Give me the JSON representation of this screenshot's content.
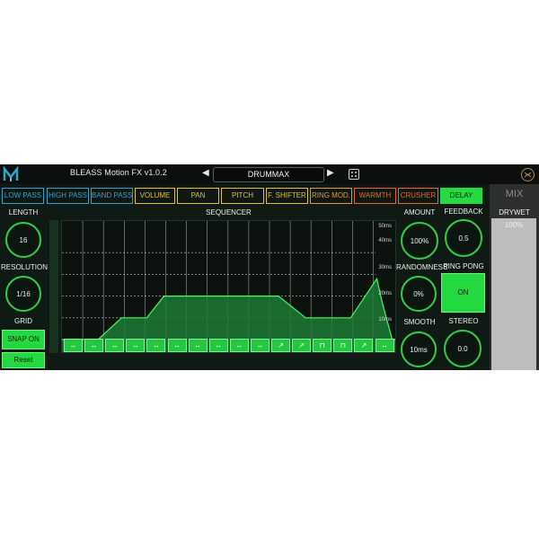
{
  "header": {
    "title": "BLEASS Motion FX  v1.0.2",
    "preset": "DRUMMAX",
    "prev_arrow": "◀",
    "next_arrow": "▶"
  },
  "tabs": [
    {
      "label": "LOW PASS",
      "color": "#3aa0c8"
    },
    {
      "label": "HIGH PASS",
      "color": "#3aa0c8"
    },
    {
      "label": "BAND PASS",
      "color": "#3aa0c8"
    },
    {
      "label": "VOLUME",
      "color": "#e0c23a"
    },
    {
      "label": "PAN",
      "color": "#e0c23a"
    },
    {
      "label": "PITCH",
      "color": "#e0c23a"
    },
    {
      "label": "F. SHIFTER",
      "color": "#e0c23a"
    },
    {
      "label": "RING MOD.",
      "color": "#e09a3a"
    },
    {
      "label": "WARMTH",
      "color": "#e06a3a"
    },
    {
      "label": "CRUSHER",
      "color": "#e06a3a"
    },
    {
      "label": "DELAY",
      "color": "#27d840",
      "active": true
    }
  ],
  "left": {
    "length_label": "LENGTH",
    "length_value": "16",
    "resolution_label": "RESOLUTION",
    "resolution_value": "1/16",
    "grid_label": "GRID",
    "snap_label": "SNAP ON",
    "reset_label": "Reset"
  },
  "sequencer": {
    "title": "SEQUENCER",
    "scale_labels": [
      "50ms",
      "40ms",
      "30ms",
      "20ms",
      "10ms",
      "0ms"
    ],
    "levels_ms": [
      0,
      10,
      10,
      20,
      20,
      20,
      20,
      20,
      20,
      20,
      20,
      10,
      10,
      10,
      10,
      10
    ],
    "step_shapes": [
      "↔",
      "↔",
      "↔",
      "↔",
      "↔",
      "↔",
      "↔",
      "↔",
      "↔",
      "↔",
      "↗",
      "↗",
      "⊓",
      "⊓",
      "↗",
      "↔"
    ]
  },
  "right": {
    "amount_label": "AMOUNT",
    "amount_value": "100%",
    "randomness_label": "RANDOMNESS",
    "randomness_value": "0%",
    "smooth_label": "SMOOTH",
    "smooth_value": "10ms",
    "feedback_label": "FEEDBACK",
    "feedback_value": "0.5",
    "pingpong_label": "PING PONG",
    "pingpong_value": "ON",
    "stereo_label": "STEREO",
    "stereo_value": "0.0"
  },
  "mix": {
    "title": "MIX",
    "drywet_label": "DRYWET",
    "drywet_value": "100%",
    "drywet_level": 1.0
  }
}
